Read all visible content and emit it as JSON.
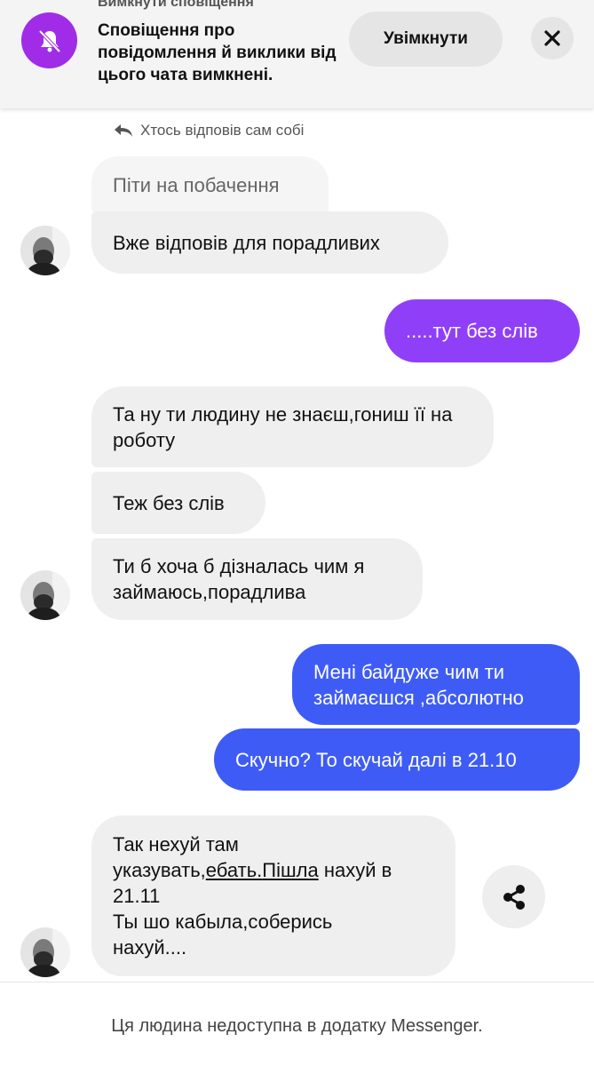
{
  "banner": {
    "cut_title": "Вимкнути сповіщення",
    "text": "Сповіщення про повідомлення й виклики від цього чата вимкнені.",
    "enable_label": "Увімкнути",
    "colors": {
      "icon_bg": "#a12ce8"
    }
  },
  "chat": {
    "reply_info": "Хтось відповів сам собі",
    "messages": [
      {
        "from": "them",
        "text": "Піти на побачення",
        "style": "quoted"
      },
      {
        "from": "them",
        "text": "Вже відповів для порадливих"
      },
      {
        "from": "me",
        "text": ".....тут без слів",
        "color": "#8f3ff7"
      },
      {
        "from": "them",
        "text": "Та ну ти людину не знаєш,гониш її на роботу"
      },
      {
        "from": "them",
        "text": "Теж без слів"
      },
      {
        "from": "them",
        "text": "Ти б хоча б дізналась чим я займаюсь,порадлива"
      },
      {
        "from": "me",
        "text": "Мені байдуже чим ти займаєшся ,абсолютно",
        "color": "#3e5cf5"
      },
      {
        "from": "me",
        "text": "Скучно? То скучай далі в 21.10",
        "color": "#3e5cf5"
      },
      {
        "from": "them",
        "text_parts": {
          "line1": "Так нехуй там",
          "line2_pre": "указувать,",
          "link1": "ебать.",
          "link2": "Пішла",
          "line2_post": " нахуй в",
          "line3": "21.11",
          "line4": "Ты шо кабыла,соберись",
          "line5": "нахуй...."
        }
      }
    ]
  },
  "share_icon": "share-icon",
  "footer": {
    "text": "Ця людина недоступна в додатку Messenger."
  }
}
